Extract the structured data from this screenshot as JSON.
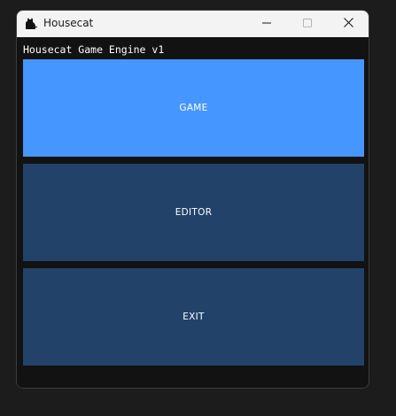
{
  "window": {
    "title": "Housecat",
    "app_icon": "cat-icon",
    "controls": {
      "minimize_icon": "minimize-icon",
      "maximize_icon": "maximize-icon",
      "close_icon": "close-icon"
    }
  },
  "main": {
    "engine_label": "Housecat Game Engine v1",
    "buttons": [
      {
        "label": "GAME",
        "color": "#4596ff",
        "state": "hovered"
      },
      {
        "label": "EDITOR",
        "color": "#234269"
      },
      {
        "label": "EXIT",
        "color": "#234269"
      }
    ]
  }
}
